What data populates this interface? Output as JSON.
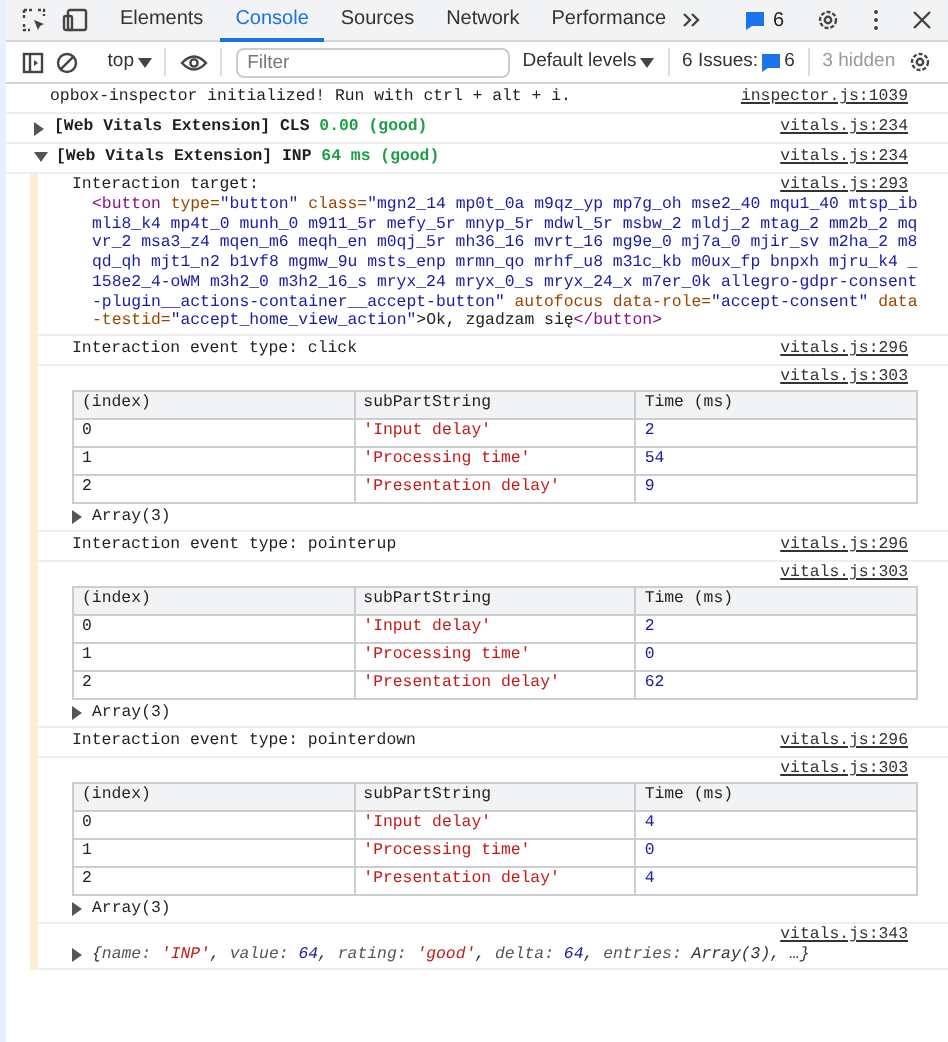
{
  "tabs": [
    {
      "label": "Elements",
      "selected": false
    },
    {
      "label": "Console",
      "selected": true
    },
    {
      "label": "Sources",
      "selected": false
    },
    {
      "label": "Network",
      "selected": false
    },
    {
      "label": "Performance",
      "selected": false
    }
  ],
  "issues_badge": "6",
  "toolbar": {
    "context": "top",
    "filter_placeholder": "Filter",
    "levels": "Default levels",
    "issues_label": "6 Issues:",
    "issues_count": "6",
    "hidden": "3 hidden"
  },
  "messages": [
    {
      "kind": "log",
      "text": "opbox-inspector initialized! Run with ctrl + alt + i.",
      "source": "inspector.js:1039"
    },
    {
      "kind": "group",
      "expanded": false,
      "label": "[Web Vitals Extension] CLS",
      "value": "0.00 (good)",
      "source": "vitals.js:234"
    },
    {
      "kind": "group",
      "expanded": true,
      "label": "[Web Vitals Extension] INP",
      "value": "64 ms (good)",
      "source": "vitals.js:234",
      "children": [
        {
          "kind": "element",
          "label": "Interaction target:",
          "source": "vitals.js:293",
          "tokens": [
            {
              "kind": "tag",
              "text": "<button"
            },
            {
              "kind": "attr",
              "text": " type="
            },
            {
              "kind": "value",
              "text": "\"button\""
            },
            {
              "kind": "attr",
              "text": " class="
            },
            {
              "kind": "value",
              "text": "\"mgn2_14 mp0t_0a m9qz_yp mp7g_oh mse2_40 mqu1_40 mtsp_ib mli8_k4 mp4t_0 munh_0 m911_5r mefy_5r mnyp_5r mdwl_5r msbw_2 mldj_2 mtag_2 mm2b_2 mqvr_2 msa3_z4 mqen_m6 meqh_en m0qj_5r mh36_16 mvrt_16 mg9e_0 mj7a_0 mjir_sv m2ha_2 m8qd_qh mjt1_n2 b1vf8 mgmw_9u msts_enp mrmn_qo mrhf_u8 m31c_kb m0ux_fp bnpxh mjru_k4 _158e2_4-oWM m3h2_0 m3h2_16_s mryx_24 mryx_0_s mryx_24_x m7er_0k allegro-gdpr-consent-plugin__actions-container__accept-button\""
            },
            {
              "kind": "attr",
              "text": " autofocus data-role="
            },
            {
              "kind": "value",
              "text": "\"accept-consent\""
            },
            {
              "kind": "attr",
              "text": " data-testid="
            },
            {
              "kind": "value",
              "text": "\"accept_home_view_action\""
            },
            {
              "kind": "text",
              "text": ">Ok, zgadzam się"
            },
            {
              "kind": "tag",
              "text": "</button>"
            }
          ]
        },
        {
          "kind": "log",
          "text": "Interaction event type: click",
          "source": "vitals.js:296"
        },
        {
          "kind": "table",
          "source": "vitals.js:303",
          "columns": [
            {
              "label": "(index)",
              "kind": "plain"
            },
            {
              "label": "subPartString",
              "kind": "string"
            },
            {
              "label": "Time (ms)",
              "kind": "number"
            }
          ],
          "rows": [
            [
              "0",
              "'Input delay'",
              "2"
            ],
            [
              "1",
              "'Processing time'",
              "54"
            ],
            [
              "2",
              "'Presentation delay'",
              "9"
            ]
          ],
          "footer": "Array(3)"
        },
        {
          "kind": "log",
          "text": "Interaction event type: pointerup",
          "source": "vitals.js:296"
        },
        {
          "kind": "table",
          "source": "vitals.js:303",
          "columns": [
            {
              "label": "(index)",
              "kind": "plain"
            },
            {
              "label": "subPartString",
              "kind": "string"
            },
            {
              "label": "Time (ms)",
              "kind": "number"
            }
          ],
          "rows": [
            [
              "0",
              "'Input delay'",
              "2"
            ],
            [
              "1",
              "'Processing time'",
              "0"
            ],
            [
              "2",
              "'Presentation delay'",
              "62"
            ]
          ],
          "footer": "Array(3)"
        },
        {
          "kind": "log",
          "text": "Interaction event type: pointerdown",
          "source": "vitals.js:296"
        },
        {
          "kind": "table",
          "source": "vitals.js:303",
          "columns": [
            {
              "label": "(index)",
              "kind": "plain"
            },
            {
              "label": "subPartString",
              "kind": "string"
            },
            {
              "label": "Time (ms)",
              "kind": "number"
            }
          ],
          "rows": [
            [
              "0",
              "'Input delay'",
              "4"
            ],
            [
              "1",
              "'Processing time'",
              "0"
            ],
            [
              "2",
              "'Presentation delay'",
              "4"
            ]
          ],
          "footer": "Array(3)"
        },
        {
          "kind": "object",
          "source": "vitals.js:343",
          "tokens": [
            {
              "kind": "punct",
              "text": "{"
            },
            {
              "kind": "key",
              "text": "name: "
            },
            {
              "kind": "string",
              "text": "'INP'"
            },
            {
              "kind": "punct",
              "text": ", "
            },
            {
              "kind": "key",
              "text": "value: "
            },
            {
              "kind": "number",
              "text": "64"
            },
            {
              "kind": "punct",
              "text": ", "
            },
            {
              "kind": "key",
              "text": "rating: "
            },
            {
              "kind": "string",
              "text": "'good'"
            },
            {
              "kind": "punct",
              "text": ", "
            },
            {
              "kind": "key",
              "text": "delta: "
            },
            {
              "kind": "number",
              "text": "64"
            },
            {
              "kind": "punct",
              "text": ", "
            },
            {
              "kind": "key",
              "text": "entries: "
            },
            {
              "kind": "punct",
              "text": "Array(3), …}"
            }
          ]
        }
      ]
    }
  ]
}
